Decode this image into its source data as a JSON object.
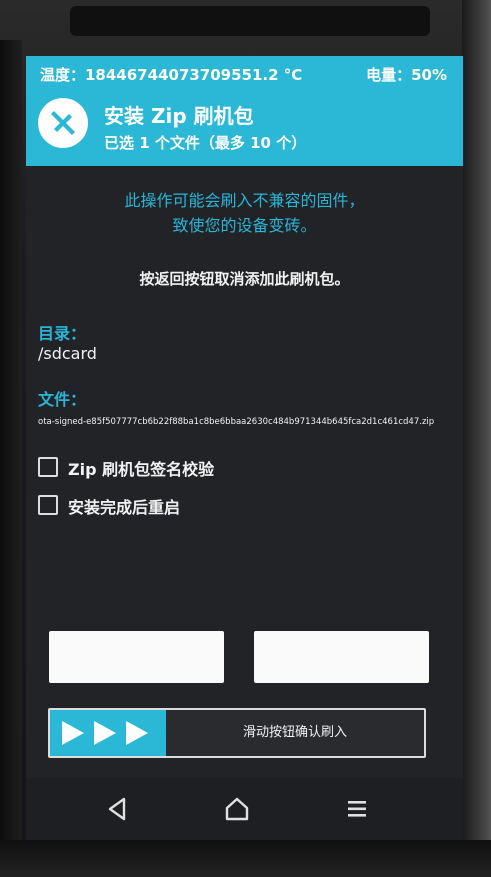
{
  "status": {
    "temperature": "温度：18446744073709551.2 °C",
    "battery": "电量：50%"
  },
  "header": {
    "title": "安装 Zip 刷机包",
    "subtitle": "已选 1 个文件（最多 10 个）"
  },
  "warning": {
    "line1": "此操作可能会刷入不兼容的固件，",
    "line2": "致使您的设备变砖。"
  },
  "back_hint": "按返回按钮取消添加此刷机包。",
  "directory": {
    "label": "目录：",
    "value": "/sdcard"
  },
  "file": {
    "label": "文件：",
    "value": "ota-signed-e85f507777cb6b22f88ba1c8be6bbaa2630c484b971344b645fca2d1c461cd47.zip"
  },
  "options": [
    {
      "label": "Zip 刷机包签名校验",
      "checked": false
    },
    {
      "label": "安装完成后重启",
      "checked": false
    }
  ],
  "buttons": {
    "left_label": "",
    "right_label": ""
  },
  "slider": {
    "label": "滑动按钮确认刷入"
  },
  "icons": {
    "logo": "twrp-logo-icon",
    "slider": "triple-arrow-icon",
    "back": "back-triangle-icon",
    "home": "home-icon",
    "menu": "menu-icon"
  },
  "colors": {
    "accent": "#2ab8d6",
    "background": "#222326",
    "text": "#f2f2f2"
  }
}
